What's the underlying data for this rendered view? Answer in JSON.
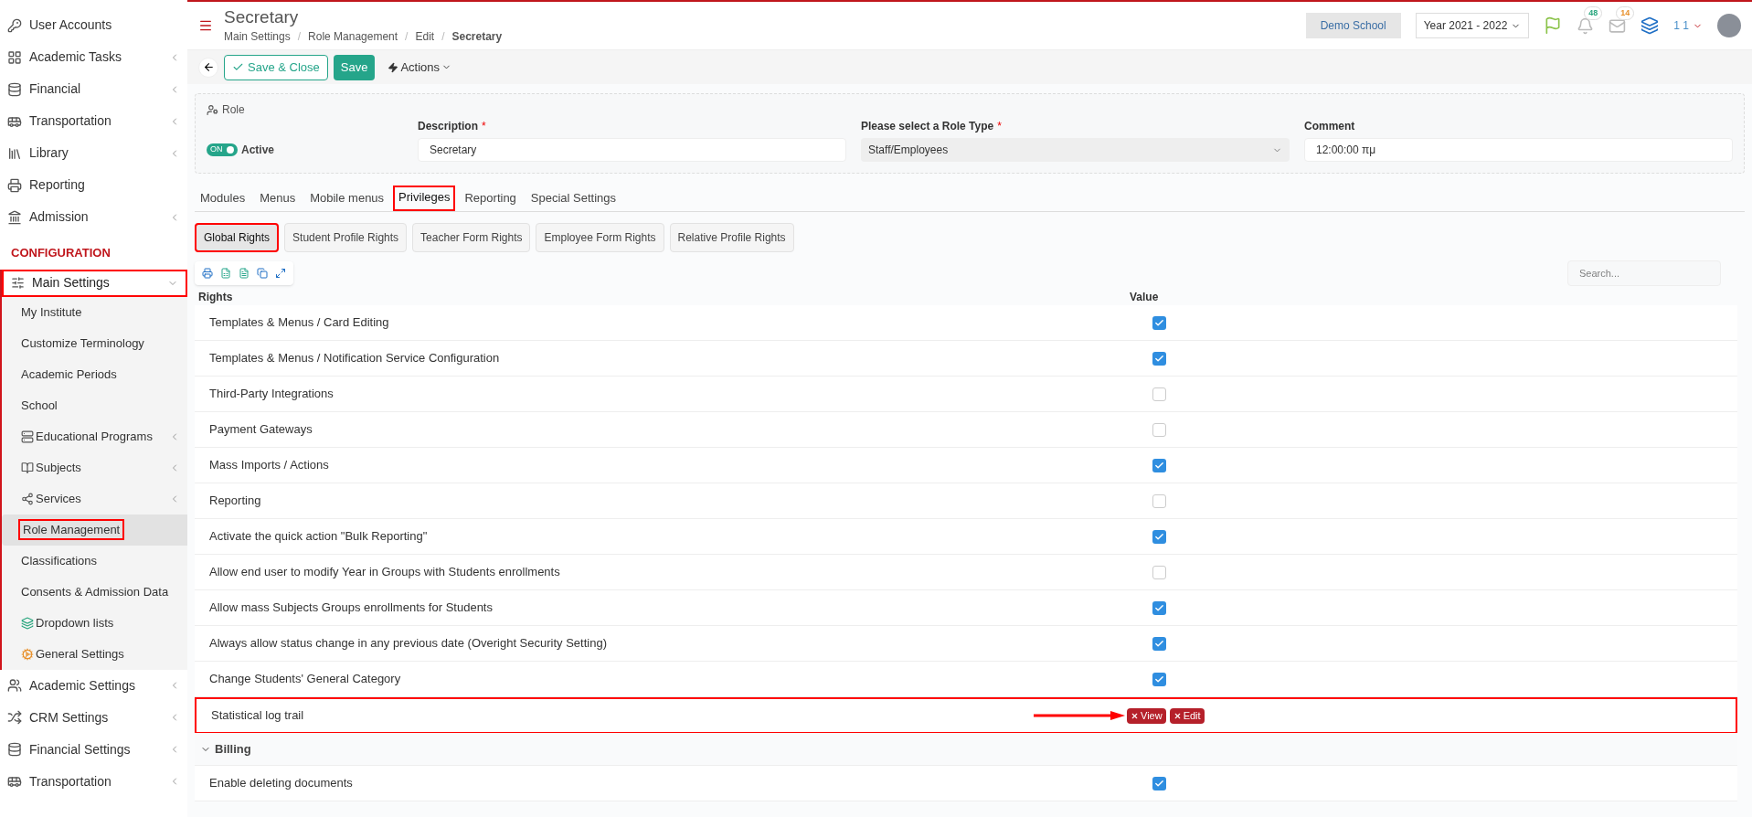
{
  "sidebar": {
    "top_items": [
      {
        "label": "User Accounts",
        "has_submenu": false
      },
      {
        "label": "Academic Tasks",
        "has_submenu": true
      },
      {
        "label": "Financial",
        "has_submenu": true
      },
      {
        "label": "Transportation",
        "has_submenu": true
      },
      {
        "label": "Library",
        "has_submenu": true
      },
      {
        "label": "Reporting",
        "has_submenu": false
      },
      {
        "label": "Admission",
        "has_submenu": true
      }
    ],
    "section_label": "CONFIGURATION",
    "group": {
      "label": "Main Settings",
      "expanded": true,
      "annotated": true,
      "children": [
        {
          "label": "My Institute",
          "has_submenu": false,
          "selected": false,
          "annotated": false
        },
        {
          "label": "Customize Terminology",
          "has_submenu": false,
          "selected": false,
          "annotated": false
        },
        {
          "label": "Academic Periods",
          "has_submenu": false,
          "selected": false,
          "annotated": false
        },
        {
          "label": "School",
          "has_submenu": false,
          "selected": false,
          "annotated": false
        },
        {
          "label": "Educational Programs",
          "has_submenu": true,
          "selected": false,
          "annotated": false
        },
        {
          "label": "Subjects",
          "has_submenu": true,
          "selected": false,
          "annotated": false
        },
        {
          "label": "Services",
          "has_submenu": true,
          "selected": false,
          "annotated": false
        },
        {
          "label": "Role Management",
          "has_submenu": false,
          "selected": true,
          "annotated": true
        },
        {
          "label": "Classifications",
          "has_submenu": false,
          "selected": false,
          "annotated": false
        },
        {
          "label": "Consents & Admission Data",
          "has_submenu": false,
          "selected": false,
          "annotated": false
        },
        {
          "label": "Dropdown lists",
          "has_submenu": false,
          "selected": false,
          "annotated": false
        },
        {
          "label": "General Settings",
          "has_submenu": false,
          "selected": false,
          "annotated": false
        }
      ]
    },
    "bottom_items": [
      {
        "label": "Academic Settings",
        "has_submenu": true
      },
      {
        "label": "CRM Settings",
        "has_submenu": true
      },
      {
        "label": "Financial Settings",
        "has_submenu": true
      },
      {
        "label": "Transportation",
        "has_submenu": true
      }
    ]
  },
  "header": {
    "title": "Secretary",
    "breadcrumb": [
      "Main Settings",
      "Role Management",
      "Edit",
      "Secretary"
    ],
    "separator": "/",
    "school": "Demo School",
    "year": "Year 2021 - 2022",
    "notifications_badge": "48",
    "messages_badge": "14",
    "user": "1 1"
  },
  "toolbar": {
    "save_close": "Save & Close",
    "save": "Save",
    "actions": "Actions"
  },
  "role": {
    "legend": "Role",
    "required_mark": "*",
    "toggle": {
      "on": true,
      "on_label": "ON"
    },
    "status_label": "Active",
    "fields": [
      {
        "label": "Description",
        "required": true,
        "value": "Secretary",
        "kind": "text"
      },
      {
        "label": "Please select a Role Type",
        "required": true,
        "value": "Staff/Employees",
        "kind": "select"
      },
      {
        "label": "Comment",
        "required": false,
        "value": "12:00:00 πμ",
        "kind": "textarea"
      }
    ]
  },
  "tabs": [
    {
      "label": "Modules",
      "selected": false,
      "annotated": false
    },
    {
      "label": "Menus",
      "selected": false,
      "annotated": false
    },
    {
      "label": "Mobile menus",
      "selected": false,
      "annotated": false
    },
    {
      "label": "Privileges",
      "selected": true,
      "annotated": true
    },
    {
      "label": "Reporting",
      "selected": false,
      "annotated": false
    },
    {
      "label": "Special Settings",
      "selected": false,
      "annotated": false
    }
  ],
  "subtabs": [
    {
      "label": "Global Rights",
      "selected": true,
      "annotated": true
    },
    {
      "label": "Student Profile Rights",
      "selected": false,
      "annotated": false
    },
    {
      "label": "Teacher Form Rights",
      "selected": false,
      "annotated": false
    },
    {
      "label": "Employee Form Rights",
      "selected": false,
      "annotated": false
    },
    {
      "label": "Relative Profile Rights",
      "selected": false,
      "annotated": false
    }
  ],
  "table": {
    "search": {
      "placeholder": "Search..."
    },
    "columns": [
      "Rights",
      "Value"
    ],
    "rows": [
      {
        "kind": "checkbox",
        "label": "Templates & Menus / Card Editing",
        "checked": true
      },
      {
        "kind": "checkbox",
        "label": "Templates & Menus / Notification Service Configuration",
        "checked": true
      },
      {
        "kind": "checkbox",
        "label": "Third-Party Integrations",
        "checked": false
      },
      {
        "kind": "checkbox",
        "label": "Payment Gateways",
        "checked": false
      },
      {
        "kind": "checkbox",
        "label": "Mass Imports / Actions",
        "checked": true
      },
      {
        "kind": "checkbox",
        "label": "Reporting",
        "checked": false
      },
      {
        "kind": "checkbox",
        "label": "Activate the quick action \"Bulk Reporting\"",
        "checked": true
      },
      {
        "kind": "checkbox",
        "label": "Allow end user to modify Year in Groups with Students enrollments",
        "checked": false
      },
      {
        "kind": "checkbox",
        "label": "Allow mass Subjects Groups enrollments for Students",
        "checked": true
      },
      {
        "kind": "checkbox",
        "label": "Always allow status change in any previous date (Overight Security Setting)",
        "checked": true
      },
      {
        "kind": "checkbox",
        "label": "Change Students' General Category",
        "checked": true
      },
      {
        "kind": "tags",
        "label": "Statistical log trail",
        "tags": [
          "View",
          "Edit"
        ],
        "annotated": true
      },
      {
        "kind": "group",
        "label": "Billing",
        "expanded": true
      },
      {
        "kind": "checkbox",
        "label": "Enable deleting documents",
        "checked": true
      }
    ]
  }
}
